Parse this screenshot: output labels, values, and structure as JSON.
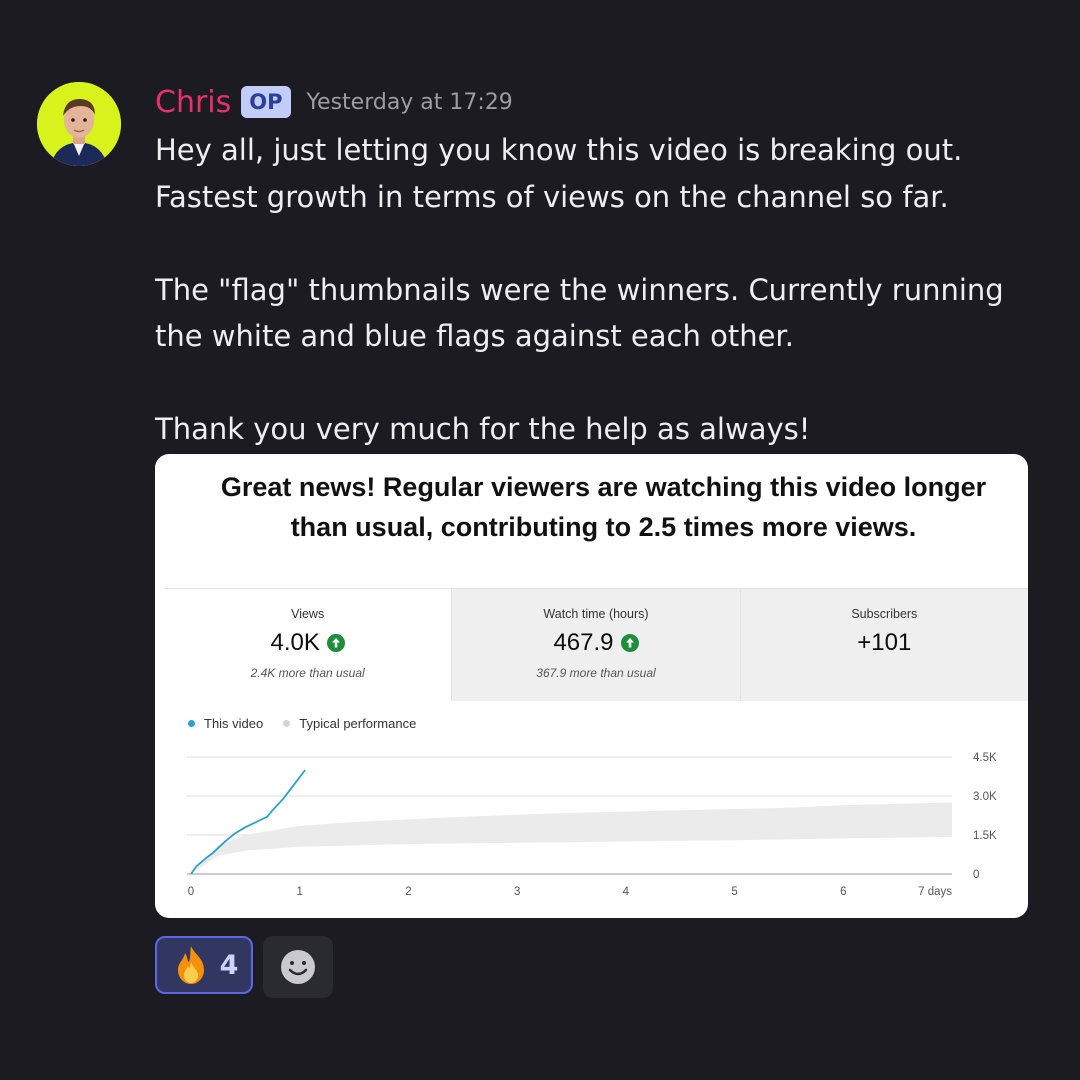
{
  "message": {
    "author": "Chris",
    "badge": "OP",
    "timestamp": "Yesterday at 17:29",
    "text": "Hey all, just letting you know this video is breaking out.\nFastest growth in terms of views on the channel so far.\n\nThe \"flag\" thumbnails were the winners. Currently running\nthe white and blue flags against each other.\n\nThank you very much for the help as always!"
  },
  "card": {
    "headline": "Great news! Regular viewers are watching this video longer than usual, contributing to 2.5 times more views.",
    "stats": [
      {
        "label": "Views",
        "value": "4.0K",
        "note": "2.4K more than usual",
        "trend": "up"
      },
      {
        "label": "Watch time (hours)",
        "value": "467.9",
        "note": "367.9 more than usual",
        "trend": "up"
      },
      {
        "label": "Subscribers",
        "value": "+101",
        "note": "",
        "trend": "none"
      }
    ],
    "legend": [
      "This video",
      "Typical performance"
    ]
  },
  "chart_data": {
    "type": "line",
    "title": "",
    "xlabel": "",
    "ylabel": "",
    "x_ticks": [
      "0",
      "1",
      "2",
      "3",
      "4",
      "5",
      "6",
      "7 days"
    ],
    "y_ticks": [
      "0",
      "1.5K",
      "3.0K",
      "4.5K"
    ],
    "xlim": [
      0,
      7
    ],
    "ylim": [
      0,
      4500
    ],
    "grid": true,
    "legend_position": "top-left",
    "series": [
      {
        "name": "This video",
        "color": "#2a9fd0",
        "x": [
          0,
          0.05,
          0.15,
          0.2,
          0.3,
          0.4,
          0.5,
          0.6,
          0.7,
          0.75,
          0.85,
          0.95,
          1.05
        ],
        "y": [
          0,
          300,
          650,
          800,
          1200,
          1550,
          1800,
          2000,
          2200,
          2450,
          2900,
          3450,
          4000
        ]
      },
      {
        "name": "Typical performance",
        "type": "band",
        "color": "#ebebeb",
        "x": [
          0,
          0.25,
          0.5,
          1,
          1.5,
          2,
          2.5,
          3,
          3.5,
          4,
          4.5,
          5,
          5.5,
          6,
          6.5,
          7
        ],
        "y_low": [
          0,
          700,
          900,
          1050,
          1100,
          1150,
          1180,
          1200,
          1220,
          1250,
          1280,
          1300,
          1330,
          1370,
          1400,
          1430
        ],
        "y_high": [
          0,
          1100,
          1500,
          1850,
          2000,
          2100,
          2200,
          2280,
          2350,
          2400,
          2450,
          2500,
          2550,
          2650,
          2700,
          2750
        ]
      }
    ]
  },
  "reactions": [
    {
      "emoji": "🔥",
      "count": "4",
      "selected": true
    }
  ],
  "colors": {
    "background": "#1c1b21",
    "username": "#e8316b",
    "badge_bg": "#c2cdfa",
    "line": "#2a9fd0",
    "up_arrow": "#1e8e3e"
  }
}
